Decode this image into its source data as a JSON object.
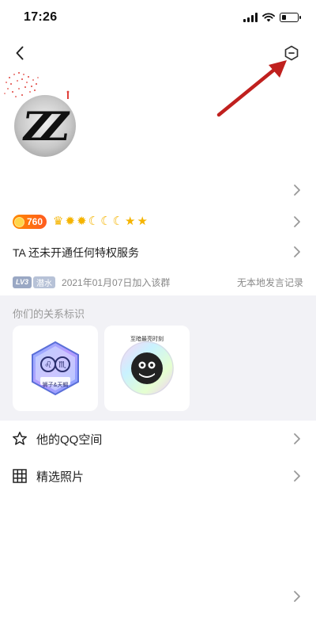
{
  "status_bar": {
    "time": "17:26",
    "battery_level": 0.3
  },
  "profile": {
    "avatar_text": "ZZ",
    "coin_count": "760",
    "level_icons": [
      "crown-icon",
      "sun-icon",
      "sun-icon",
      "moon-icon",
      "moon-icon",
      "moon-icon",
      "star-icon",
      "star-icon"
    ],
    "privilege_text": "TA 还未开通任何特权服务",
    "group_level": "LV3",
    "group_tag": "潜水",
    "join_date": "2021年01月07日加入该群",
    "message_record": "无本地发言记录"
  },
  "relationship": {
    "title": "你们的关系标识",
    "cards": [
      {
        "caption": "狮子&天蝎"
      },
      {
        "caption": "至暗最亮时刻"
      }
    ]
  },
  "menu": [
    {
      "label": "他的QQ空间",
      "icon": "star-outline-icon"
    },
    {
      "label": "精选照片",
      "icon": "grid-icon"
    }
  ],
  "colors": {
    "accent_orange": "#ff6a1a",
    "annotation_red": "#c0201e",
    "section_bg": "#f2f2f6"
  }
}
